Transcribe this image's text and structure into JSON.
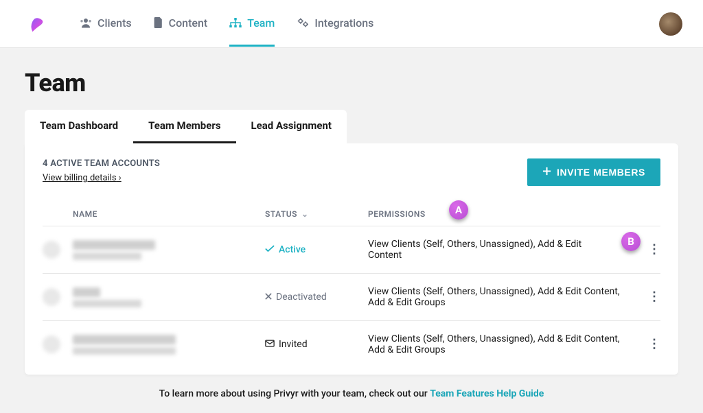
{
  "nav": {
    "clients": "Clients",
    "content": "Content",
    "team": "Team",
    "integrations": "Integrations"
  },
  "page_title": "Team",
  "tabs": {
    "dashboard": "Team Dashboard",
    "members": "Team Members",
    "lead_assignment": "Lead Assignment"
  },
  "accounts_count_label": "4 ACTIVE TEAM ACCOUNTS",
  "billing_link": "View billing details",
  "invite_button": "INVITE MEMBERS",
  "table": {
    "headers": {
      "name": "Name",
      "status": "Status",
      "permissions": "Permissions"
    },
    "rows": [
      {
        "status_kind": "active",
        "status_label": "Active",
        "permissions": "View Clients (Self, Others, Unassigned), Add & Edit Content"
      },
      {
        "status_kind": "deactivated",
        "status_label": "Deactivated",
        "permissions": "View Clients (Self, Others, Unassigned), Add & Edit Content, Add & Edit Groups"
      },
      {
        "status_kind": "invited",
        "status_label": "Invited",
        "permissions": "View Clients (Self, Others, Unassigned), Add & Edit Content, Add & Edit Groups"
      }
    ]
  },
  "markers": {
    "a": "A",
    "b": "B"
  },
  "footer": {
    "prefix": "To learn more about using Privyr with your team, check out our ",
    "link": "Team Features Help Guide"
  }
}
